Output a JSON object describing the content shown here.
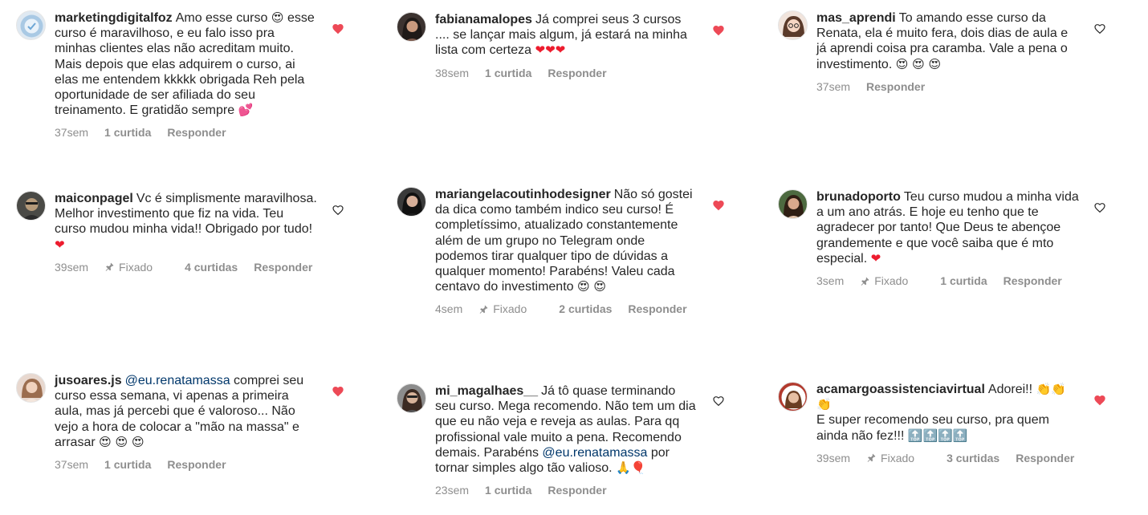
{
  "columns": [
    [
      {
        "username": "marketingdigitalfoz",
        "text": "Amo esse curso",
        "text_end": "esse curso é maravilhoso, e eu falo isso pra minhas clientes elas não acreditam muito. Mais depois que elas adquirem o curso, ai elas me entendem kkkkk obrigada Reh pela oportunidade de ser afiliada do seu treinamento. E gratidão sempre",
        "emoji_after_text": "heart-eyes",
        "emoji_end": "two-hearts",
        "time": "37sem",
        "likes": "1 curtida",
        "reply": "Responder",
        "pinned": "",
        "liked": true,
        "avatar": "logo"
      },
      {
        "username": "maiconpagel",
        "text": "Vc é simplismente maravilhosa. Melhor investimento que fiz na vida. Teu curso mudou minha vida!! Obrigado por tudo!",
        "emoji_end": "red-heart",
        "time": "39sem",
        "pinned": "Fixado",
        "likes": "4 curtidas",
        "reply": "Responder",
        "liked": false,
        "avatar": "man"
      },
      {
        "username": "jusoares.js",
        "mention": "@eu.renatamassa",
        "text": "comprei seu curso essa semana, vi apenas a primeira aula, mas já percebi que é valoroso... Não vejo a hora de colocar a \"mão na massa\" e arrasar",
        "emoji_end": "heart-eyes x3",
        "time": "37sem",
        "likes": "1 curtida",
        "reply": "Responder",
        "pinned": "",
        "liked": true,
        "avatar": "woman-light"
      }
    ],
    [
      {
        "username": "fabianamalopes",
        "text": "Já comprei seus 3 cursos .... se lançar mais algum, já estará na minha lista com certeza",
        "emoji_end": "red-heart x3",
        "time": "38sem",
        "likes": "1 curtida",
        "reply": "Responder",
        "pinned": "",
        "liked": true,
        "avatar": "woman-dark"
      },
      {
        "username": "mariangelacoutinhodesigner",
        "text": "Não só gostei da dica como também indico seu curso! É completíssimo, atualizado constantemente além de um grupo no Telegram onde podemos tirar qualquer tipo de dúvidas a qualquer momento! Parabéns! Valeu cada centavo do investimento",
        "emoji_end": "heart-eyes x2",
        "time": "4sem",
        "pinned": "Fixado",
        "likes": "2 curtidas",
        "reply": "Responder",
        "liked": true,
        "avatar": "woman-dark"
      },
      {
        "username": "mi_magalhaes__",
        "text": "Já tô quase terminando seu curso. Mega recomendo. Não tem um dia que eu não veja e reveja as aulas. Para qq profissional vale muito a pena. Recomendo demais. Parabéns",
        "mention": "@eu.renatamassa",
        "text_end": "por tornar simples algo tão valioso.",
        "emoji_end": "folded-hands balloon",
        "time": "23sem",
        "likes": "1 curtida",
        "reply": "Responder",
        "pinned": "",
        "liked": false,
        "avatar": "woman-glasses"
      }
    ],
    [
      {
        "username": "mas_aprendi",
        "text": "To amando esse curso da Renata, ela é muito fera, dois dias de aula e já aprendi coisa pra caramba. Vale a pena o investimento.",
        "emoji_end": "heart-eyes x3",
        "time": "37sem",
        "likes": "",
        "reply": "Responder",
        "pinned": "",
        "liked": false,
        "avatar": "cartoon"
      },
      {
        "username": "brunadoporto",
        "text": "Teu curso mudou a minha vida a um ano atrás. E hoje eu tenho que te agradecer por tanto! Que Deus te abençoe grandemente e que você saiba que é mto especial.",
        "emoji_end": "red-heart",
        "time": "3sem",
        "pinned": "Fixado",
        "likes": "1 curtida",
        "reply": "Responder",
        "liked": false,
        "avatar": "woman-green"
      },
      {
        "username": "acamargoassistenciavirtual",
        "text": "Adorei!!",
        "emoji_after_text": "clapping x3",
        "text_end": "E super recomendo seu curso, pra quem ainda não fez!!!",
        "emoji_end": "TOP x4",
        "time": "39sem",
        "pinned": "Fixado",
        "likes": "3 curtidas",
        "reply": "Responder",
        "liked": true,
        "avatar": "woman-red"
      }
    ]
  ],
  "colors": {
    "liked_heart": "#ed4956",
    "meta_text": "#8e8e8e",
    "mention": "#00376b",
    "text": "#262626"
  }
}
